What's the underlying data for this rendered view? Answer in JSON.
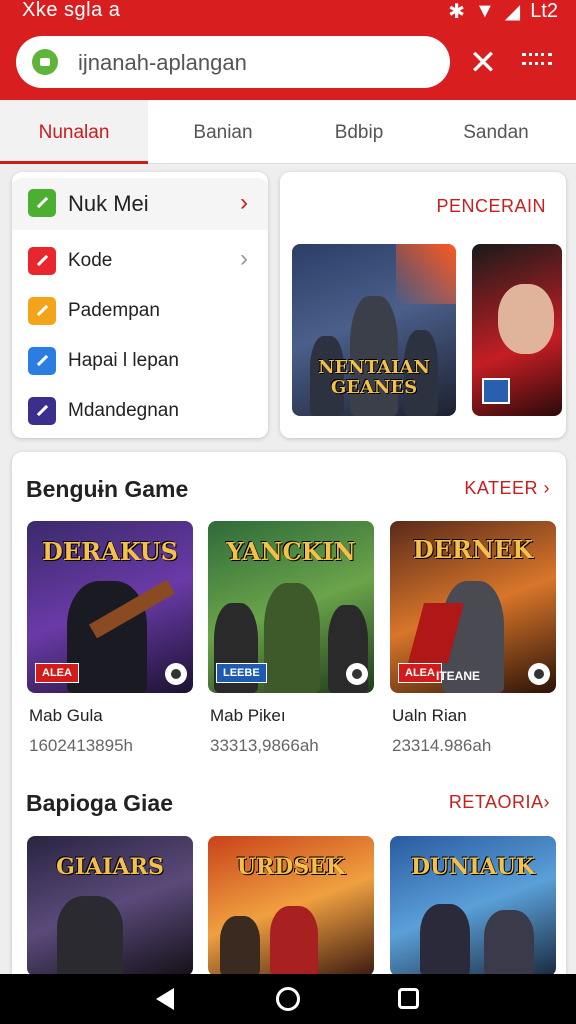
{
  "status_bar": {
    "left_text": "Xke sgla  a",
    "right_text": "Lt2"
  },
  "address_bar": {
    "url": "ijnanah-aplangan"
  },
  "tabs": [
    {
      "label": "Nunalan",
      "active": true
    },
    {
      "label": "Banian",
      "active": false
    },
    {
      "label": "Bdbip",
      "active": false
    },
    {
      "label": "Sandan",
      "active": false
    }
  ],
  "side_menu": {
    "header": "Nuk Mei",
    "items": [
      {
        "label": "Kode",
        "color": "#e8262c",
        "icon": "external-link-icon"
      },
      {
        "label": "Padempan",
        "color": "#f3a419",
        "icon": "pencil-icon"
      },
      {
        "label": "Hapai l lepan",
        "color": "#2a7de1",
        "icon": "edit-icon"
      },
      {
        "label": "Mdandegnan",
        "color": "#3a2f8c",
        "icon": "camera-icon"
      }
    ]
  },
  "promo": {
    "link": "PENCERAIN",
    "tiles": [
      {
        "caption": "NENTAIAN GEANES"
      },
      {
        "caption": ""
      }
    ]
  },
  "section1": {
    "title": "Benguɨn Game",
    "link": "KATEER",
    "games": [
      {
        "art_title": "DERAKUS",
        "badge": "ALEA",
        "name": "Mab Gula",
        "sub": "1602413895h"
      },
      {
        "art_title": "YANCKIN",
        "badge": "LEEBE",
        "name": "Mab Pikeı",
        "sub": "33313,9866ah"
      },
      {
        "art_title": "DERNEK",
        "badge": "ALEA",
        "badge2": "ITEANE",
        "name": "Ualn Rian",
        "sub": "23314.986ah"
      }
    ]
  },
  "section2": {
    "title": "Bapioga Giae",
    "link": "RETAORIA",
    "games": [
      {
        "art_title": "GIAIARS"
      },
      {
        "art_title": "URDSEK"
      },
      {
        "art_title": "DUNIAUK"
      }
    ]
  },
  "colors": {
    "accent": "#d81e1e"
  }
}
